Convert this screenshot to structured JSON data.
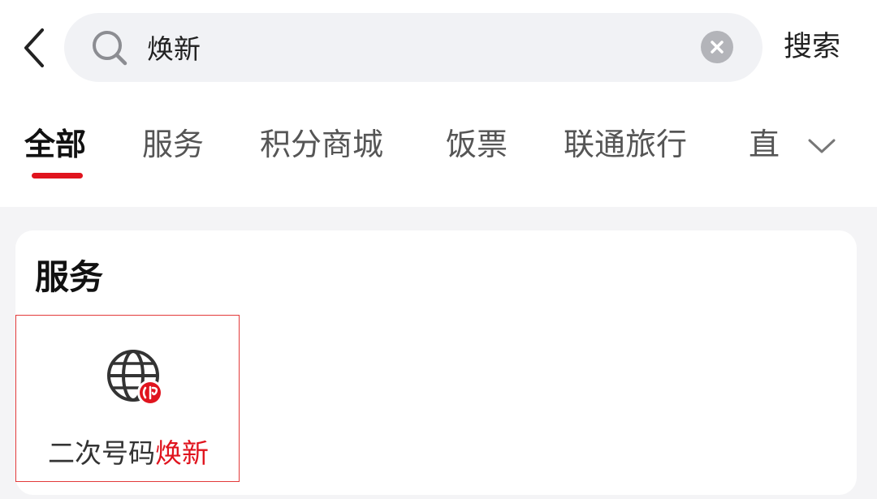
{
  "search": {
    "query": "焕新",
    "submit_label": "搜索"
  },
  "tabs": [
    {
      "label": "全部",
      "active": true
    },
    {
      "label": "服务",
      "active": false
    },
    {
      "label": "积分商城",
      "active": false
    },
    {
      "label": "饭票",
      "active": false
    },
    {
      "label": "联通旅行",
      "active": false
    },
    {
      "label": "直",
      "active": false
    }
  ],
  "section": {
    "title": "服务",
    "items": [
      {
        "label_prefix": "二次号码",
        "label_highlight": "焕新",
        "icon": "globe-badge-icon"
      }
    ]
  },
  "colors": {
    "accent": "#e0141e",
    "background": "#f4f4f6",
    "search_bg": "#f1f2f5"
  }
}
